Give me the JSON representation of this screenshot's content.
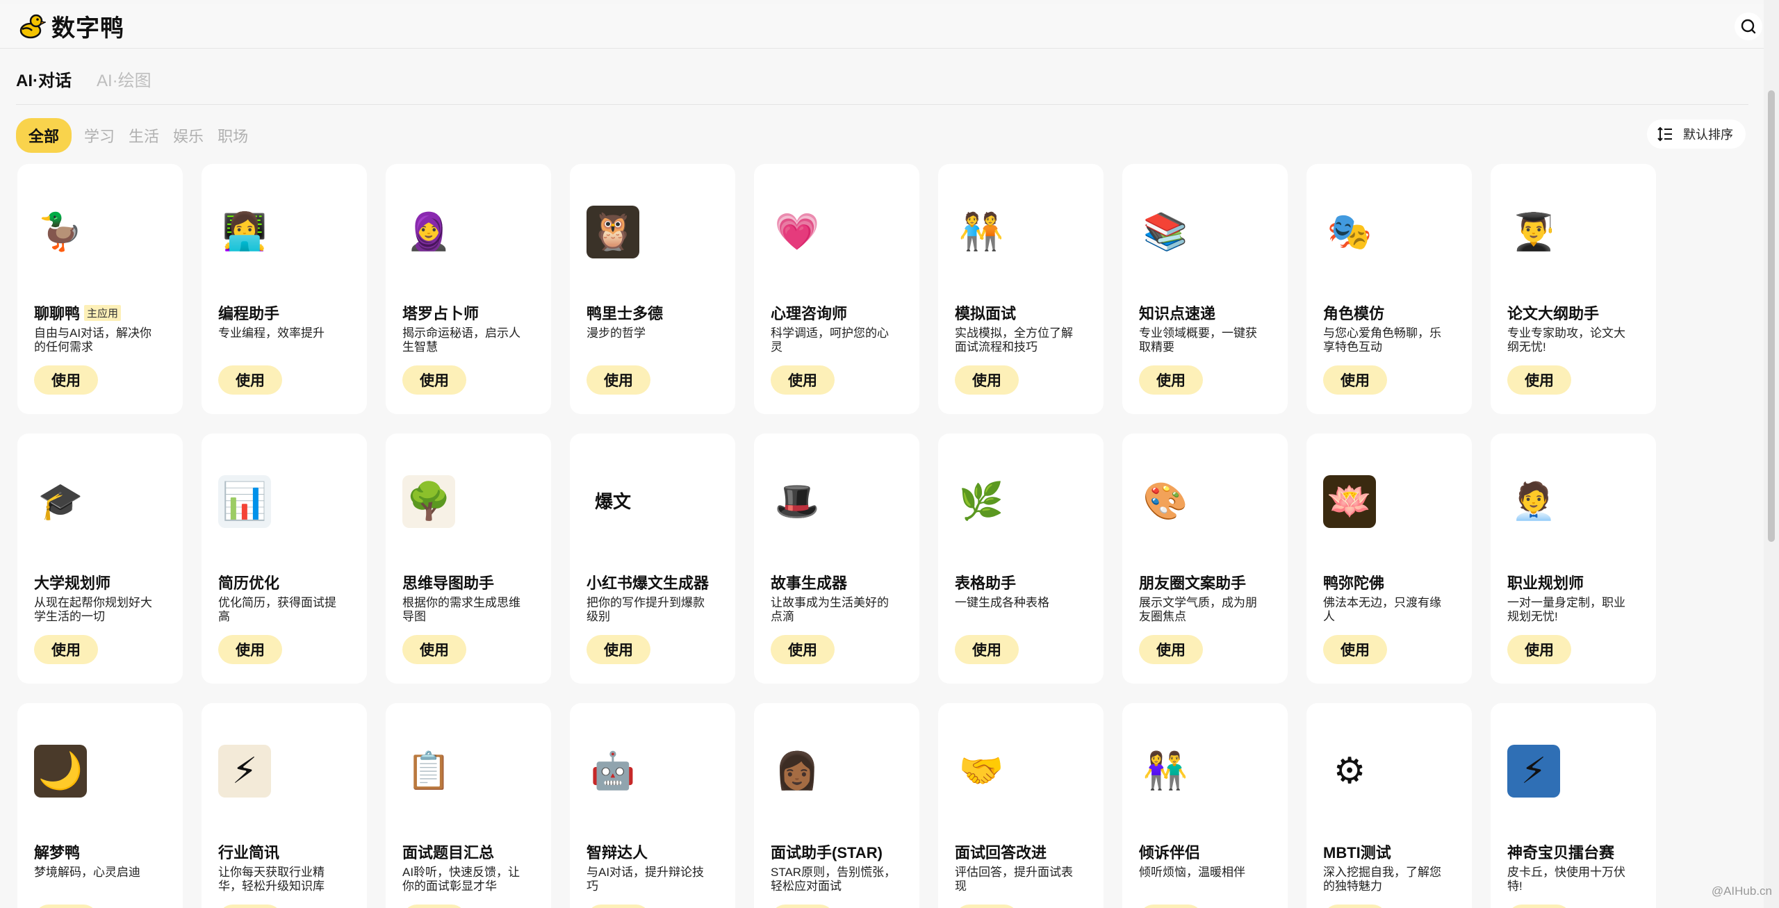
{
  "app": {
    "name": "数字鸭"
  },
  "mode_tabs": [
    {
      "label": "AI·对话",
      "active": true
    },
    {
      "label": "AI·绘图",
      "active": false
    }
  ],
  "categories": [
    {
      "label": "全部",
      "active": true
    },
    {
      "label": "学习",
      "active": false
    },
    {
      "label": "生活",
      "active": false
    },
    {
      "label": "娱乐",
      "active": false
    },
    {
      "label": "职场",
      "active": false
    }
  ],
  "sort": {
    "label": "默认排序"
  },
  "use_label": "使用",
  "cards": [
    {
      "title": "聊聊鸭",
      "tag": "主应用",
      "desc": "自由与AI对话，解决你的任何需求",
      "icon": "duck-detective",
      "glyph": "🦆",
      "bg": "#ffffff"
    },
    {
      "title": "编程助手",
      "desc": "专业编程，效率提升",
      "icon": "programmer-woman",
      "glyph": "👩‍💻",
      "bg": "#ffffff"
    },
    {
      "title": "塔罗占卜师",
      "desc": "揭示命运秘语，启示人生智慧",
      "icon": "tarot-hooded-woman",
      "glyph": "🧕",
      "bg": "#ffffff"
    },
    {
      "title": "鸭里士多德",
      "desc": "漫步的哲学",
      "icon": "philosopher-portrait",
      "glyph": "🦉",
      "bg": "#3a3228"
    },
    {
      "title": "心理咨询师",
      "desc": "科学调适，呵护您的心灵",
      "icon": "man-holding-heart",
      "glyph": "💗",
      "bg": "#ffffff"
    },
    {
      "title": "模拟面试",
      "desc": "实战模拟，全方位了解面试流程和技巧",
      "icon": "interview-people",
      "glyph": "🧑‍🤝‍🧑",
      "bg": "#ffffff"
    },
    {
      "title": "知识点速递",
      "desc": "专业领域概要，一键获取精要",
      "icon": "book-stack",
      "glyph": "📚",
      "bg": "#ffffff"
    },
    {
      "title": "角色模仿",
      "desc": "与您心爱角色畅聊，乐享特色互动",
      "icon": "character-grid",
      "glyph": "🎭",
      "bg": "#ffffff"
    },
    {
      "title": "论文大纲助手",
      "desc": "专业专家助攻，论文大纲无忧!",
      "icon": "graduate-professor",
      "glyph": "👨‍🎓",
      "bg": "#ffffff"
    },
    {
      "title": "大学规划师",
      "desc": "从现在起帮你规划好大学生活的一切",
      "icon": "graduate-elder",
      "glyph": "🎓",
      "bg": "#ffffff"
    },
    {
      "title": "简历优化",
      "desc": "优化简历，获得面试提高",
      "icon": "resume-badge",
      "glyph": "📊",
      "bg": "#eef3f6"
    },
    {
      "title": "思维导图助手",
      "desc": "根据你的需求生成思维导图",
      "icon": "mind-tree",
      "glyph": "🌳",
      "bg": "#f7f1e6"
    },
    {
      "title": "小红书爆文生成器",
      "desc": "把你的写作提升到爆款级别",
      "icon": "xiaohongshu-logo",
      "glyph": "爆文",
      "bg": "#ffffff"
    },
    {
      "title": "故事生成器",
      "desc": "让故事成为生活美好的点滴",
      "icon": "magic-hat",
      "glyph": "🎩",
      "bg": "#ffffff"
    },
    {
      "title": "表格助手",
      "desc": "一键生成各种表格",
      "icon": "plant-sprout",
      "glyph": "🌿",
      "bg": "#ffffff"
    },
    {
      "title": "朋友圈文案助手",
      "desc": "展示文学气质，成为朋友圈焦点",
      "icon": "color-wheel",
      "glyph": "🎨",
      "bg": "#ffffff"
    },
    {
      "title": "鸭弥陀佛",
      "desc": "佛法本无边，只渡有缘人",
      "icon": "golden-buddha",
      "glyph": "🪷",
      "bg": "#3a2a10"
    },
    {
      "title": "职业规划师",
      "desc": "一对一量身定制，职业规划无忧!",
      "icon": "career-man",
      "glyph": "🧑‍💼",
      "bg": "#ffffff"
    },
    {
      "title": "解梦鸭",
      "desc": "梦境解码，心灵启迪",
      "icon": "dream-duck",
      "glyph": "🌙",
      "bg": "#4a3a2a"
    },
    {
      "title": "行业简讯",
      "desc": "让你每天获取行业精华，轻松升级知识库",
      "icon": "newsletter-lightning",
      "glyph": "⚡",
      "bg": "#f3ead8"
    },
    {
      "title": "面试题目汇总",
      "desc": "AI聆听，快速反馈，让你的面试彰显才华",
      "icon": "clipboard-pencil",
      "glyph": "📋",
      "bg": "#ffffff"
    },
    {
      "title": "智辩达人",
      "desc": "与AI对话，提升辩论技巧",
      "icon": "robot-head",
      "glyph": "🤖",
      "bg": "#ffffff"
    },
    {
      "title": "面试助手(STAR)",
      "desc": "STAR原则，告别慌张，轻松应对面试",
      "icon": "interview-woman",
      "glyph": "👩🏾",
      "bg": "#ffffff"
    },
    {
      "title": "面试回答改进",
      "desc": "评估回答，提升面试表现",
      "icon": "interview-table",
      "glyph": "🤝",
      "bg": "#ffffff"
    },
    {
      "title": "倾诉伴侣",
      "desc": "倾听烦恼，温暖相伴",
      "icon": "couple-companion",
      "glyph": "👫",
      "bg": "#ffffff"
    },
    {
      "title": "MBTI测试",
      "desc": "深入挖掘自我，了解您的独特魅力",
      "icon": "mbti-wheel",
      "glyph": "⚙",
      "bg": "#ffffff"
    },
    {
      "title": "神奇宝贝擂台赛",
      "desc": "皮卡丘，快使用十万伏特!",
      "icon": "pokemon-go",
      "glyph": "⚡",
      "bg": "#2f6fb5"
    }
  ],
  "watermark": "@AIHub.cn",
  "colors": {
    "accent": "#f9d34c",
    "button_bg": "#fdf0b8",
    "page_bg": "#f7f7f7"
  }
}
